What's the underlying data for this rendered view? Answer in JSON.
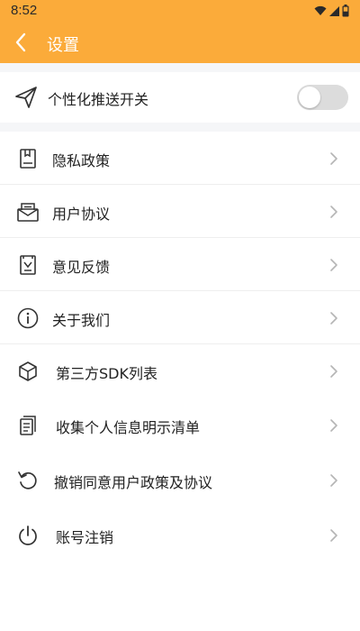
{
  "status_bar": {
    "time": "8:52",
    "icons": [
      "wifi-icon",
      "signal-icon",
      "battery-icon"
    ]
  },
  "app_bar": {
    "title": "设置",
    "back_icon": "chevron-left-icon",
    "color": "#fbab3a"
  },
  "push_setting": {
    "label": "个性化推送开关",
    "icon": "send-icon",
    "enabled": false
  },
  "menu": {
    "items": [
      {
        "label": "隐私政策",
        "icon": "document-icon"
      },
      {
        "label": "用户协议",
        "icon": "envelope-icon"
      },
      {
        "label": "意见反馈",
        "icon": "feedback-icon"
      },
      {
        "label": "关于我们",
        "icon": "info-icon"
      },
      {
        "label": "第三方SDK列表",
        "icon": "cube-icon"
      },
      {
        "label": "收集个人信息明示清单",
        "icon": "list-document-icon"
      },
      {
        "label": "撤销同意用户政策及协议",
        "icon": "revoke-icon"
      },
      {
        "label": "账号注销",
        "icon": "power-icon"
      }
    ]
  }
}
